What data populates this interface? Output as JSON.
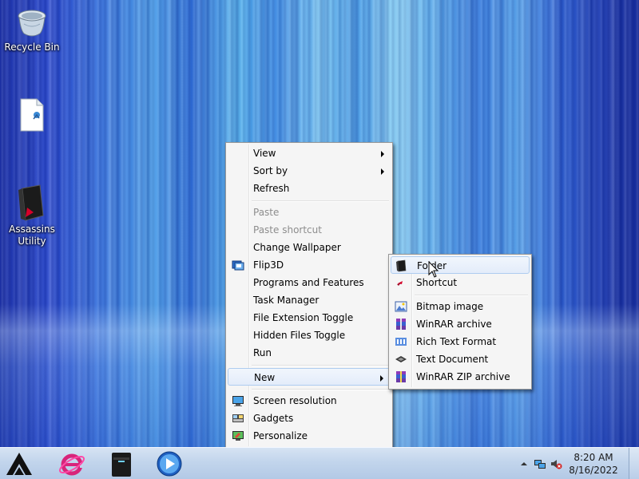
{
  "desktop": {
    "icons": [
      {
        "label": "Recycle Bin",
        "icon": "recycle-bin-icon"
      },
      {
        "label": "",
        "icon": "document-icon"
      },
      {
        "label": "Assassins Utility",
        "icon": "assassins-utility-icon"
      }
    ]
  },
  "context_menu": {
    "items": [
      {
        "label": "View",
        "has_submenu": true
      },
      {
        "label": "Sort by",
        "has_submenu": true
      },
      {
        "label": "Refresh"
      },
      {
        "label": "Paste",
        "disabled": true
      },
      {
        "label": "Paste shortcut",
        "disabled": true
      },
      {
        "label": "Change Wallpaper"
      },
      {
        "label": "Flip3D",
        "icon": "flip3d-icon"
      },
      {
        "label": "Programs and Features"
      },
      {
        "label": "Task Manager"
      },
      {
        "label": "File Extension Toggle"
      },
      {
        "label": "Hidden Files Toggle"
      },
      {
        "label": "Run"
      },
      {
        "label": "New",
        "has_submenu": true,
        "highlighted": true
      },
      {
        "label": "Screen resolution",
        "icon": "monitor-icon"
      },
      {
        "label": "Gadgets",
        "icon": "gadgets-icon"
      },
      {
        "label": "Personalize",
        "icon": "personalize-icon"
      }
    ]
  },
  "new_submenu": {
    "items": [
      {
        "label": "Folder",
        "icon": "folder-icon",
        "highlighted": true
      },
      {
        "label": "Shortcut",
        "icon": "shortcut-icon"
      },
      {
        "label": "Bitmap image",
        "icon": "bitmap-icon"
      },
      {
        "label": "WinRAR archive",
        "icon": "winrar-icon"
      },
      {
        "label": "Rich Text Format",
        "icon": "rtf-icon"
      },
      {
        "label": "Text Document",
        "icon": "text-document-icon"
      },
      {
        "label": "WinRAR ZIP archive",
        "icon": "winrar-zip-icon"
      }
    ]
  },
  "taskbar": {
    "pinned": [
      "start-button",
      "internet-explorer-icon",
      "file-explorer-icon",
      "media-player-icon"
    ],
    "clock": {
      "time": "8:20 AM",
      "date": "8/16/2022"
    }
  },
  "colors": {
    "menu_bg": "#f5f5f5",
    "highlight_border": "#aeccf0",
    "disabled_text": "#8d8d8d",
    "taskbar": "#c2d5ec"
  }
}
